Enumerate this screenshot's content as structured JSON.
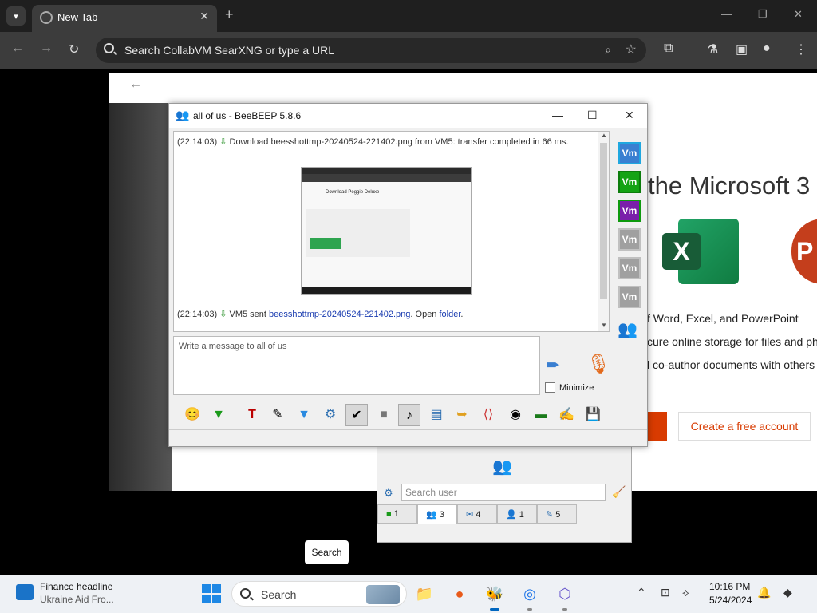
{
  "browser": {
    "tab_title": "New Tab",
    "omnibox_text": "Search CollabVM SearXNG or type a URL"
  },
  "webpage": {
    "headline": "the Microsoft 3",
    "bullets": [
      "f Word, Excel, and PowerPoint",
      "cure online storage for files and ph",
      "l co-author documents with others"
    ],
    "cta_label": "Create a free account",
    "excel_letter": "X",
    "ppt_letter": "P"
  },
  "beebeep": {
    "window_title": "all of us - BeeBEEP 5.8.6",
    "chat": {
      "line1_time": "(22:14:03)",
      "line1_text": "Download beesshottmp-20240524-221402.png from VM5: transfer completed in 66 ms.",
      "line2_time": "(22:14:03)",
      "line2_prefix": "VM5 sent",
      "line2_link": "beesshottmp-20240524-221402.png",
      "line2_mid": ". Open",
      "line2_folder": "folder",
      "line2_end": "."
    },
    "thumbnail": {
      "title": "Download Peggie Deluxe"
    },
    "input_placeholder": "Write a message to all of us",
    "minimize_label": "Minimize",
    "vm_label": "Vm",
    "vm_icons": [
      {
        "color": "blue"
      },
      {
        "color": "green"
      },
      {
        "color": "purple"
      },
      {
        "color": "gray"
      },
      {
        "color": "gray"
      },
      {
        "color": "gray"
      }
    ],
    "search_user_placeholder": "Search user",
    "tabs": [
      {
        "count": "1",
        "icon": "users-online-icon"
      },
      {
        "count": "3",
        "icon": "groups-icon"
      },
      {
        "count": "4",
        "icon": "chats-icon"
      },
      {
        "count": "1",
        "icon": "saved-chats-icon"
      },
      {
        "count": "5",
        "icon": "file-share-icon"
      }
    ]
  },
  "tooltip": {
    "search": "Search"
  },
  "taskbar": {
    "news_title": "Finance headline",
    "news_sub": "Ukraine Aid Fro...",
    "search_label": "Search",
    "time": "10:16 PM",
    "date": "5/24/2024"
  },
  "colors": {
    "accent_orange": "#d83b01",
    "excel_green": "#107c41",
    "link_blue": "#1a3cb0"
  }
}
